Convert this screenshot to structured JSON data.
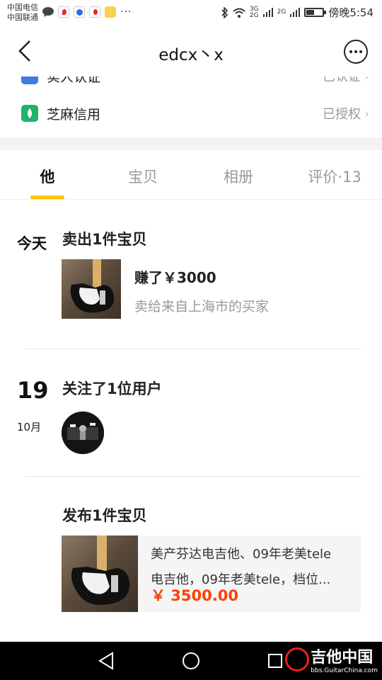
{
  "statusbar": {
    "carrier1": "中国电信",
    "carrier2": "中国联通",
    "dots": "···",
    "sig1": "3G",
    "sig2": "2G",
    "sig3": "2G",
    "time": "傍晚5:54",
    "battery_level": 0.5
  },
  "nav": {
    "title": "edcx丶x"
  },
  "verify": {
    "row1_label": "实人认证",
    "row1_status": "已认证",
    "row2_label": "芝麻信用",
    "row2_status": "已授权",
    "chevron": "›"
  },
  "tabs": [
    {
      "label": "他",
      "active": true
    },
    {
      "label": "宝贝",
      "active": false
    },
    {
      "label": "相册",
      "active": false
    },
    {
      "label": "评价·13",
      "active": false
    }
  ],
  "timeline": {
    "event1": {
      "date": "今天",
      "title": "卖出1件宝贝",
      "amount": "赚了￥3000",
      "sub": "卖给来自上海市的买家"
    },
    "event2": {
      "day": "19",
      "month": "10月",
      "title": "关注了1位用户"
    },
    "event3": {
      "title": "发布1件宝贝",
      "desc_line1": "美产芬达电吉他、09年老美tele",
      "desc_line2": "电吉他，09年老美tele，档位...",
      "price": "￥ 3500.00"
    }
  },
  "watermark": {
    "main": "吉他中国",
    "sub": "bbs.GuitarChina.com"
  },
  "colors": {
    "accent": "#ffc600",
    "price": "#ff4000",
    "muted": "#999999"
  }
}
